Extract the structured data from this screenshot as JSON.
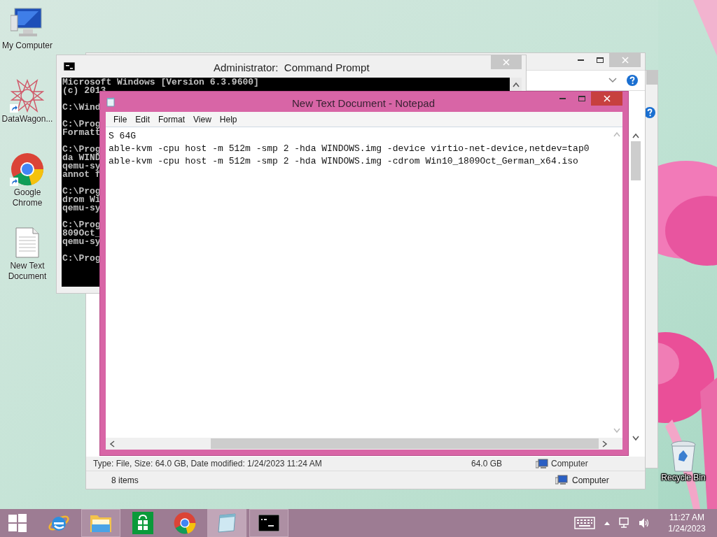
{
  "desktop_icons": [
    {
      "kind": "computer",
      "label": "My Computer",
      "shortcut": false
    },
    {
      "kind": "star",
      "label": "DataWagon...",
      "shortcut": true
    },
    {
      "kind": "chrome",
      "label": "Google Chrome",
      "shortcut": true
    },
    {
      "kind": "document",
      "label": "New Text Document",
      "shortcut": false
    }
  ],
  "recycle_bin": {
    "label": "Recycle Bin"
  },
  "explorer": {
    "details": {
      "summary": "Type: File, Size: 64.0 GB, Date modified: 1/24/2023 11:24 AM",
      "size": "64.0 GB",
      "location": "Computer"
    },
    "status": {
      "items": "8 items",
      "location": "Computer"
    }
  },
  "command_prompt": {
    "title": "Administrator:  Command Prompt",
    "blocks": [
      [
        "Microsoft Windows [Version 6.3.9600]",
        "(c) 2013"
      ],
      [
        "C:\\Wind"
      ],
      [
        "C:\\Prog",
        "Formatt"
      ],
      [
        "C:\\Prog",
        "da WIND",
        "qemu-sy",
        "annot f"
      ],
      [
        "C:\\Prog",
        "drom Wi",
        "qemu-sy"
      ],
      [
        "C:\\Prog",
        "809Oct_",
        "qemu-sy"
      ],
      [
        "C:\\Prog"
      ]
    ]
  },
  "notepad": {
    "title": "New Text Document - Notepad",
    "menu": [
      "File",
      "Edit",
      "Format",
      "View",
      "Help"
    ],
    "lines": [
      "S 64G",
      "able-kvm -cpu host -m 512m -smp 2 -hda WINDOWS.img -device virtio-net-device,netdev=tap0",
      "able-kvm -cpu host -m 512m -smp 2 -hda WINDOWS.img -cdrom Win10_1809Oct_German_x64.iso"
    ]
  },
  "taskbar": {
    "apps": [
      {
        "kind": "ie",
        "running": false,
        "active": false
      },
      {
        "kind": "explorer",
        "running": true,
        "active": false
      },
      {
        "kind": "store",
        "running": false,
        "active": false
      },
      {
        "kind": "chrome",
        "running": false,
        "active": false
      },
      {
        "kind": "notepad",
        "running": true,
        "active": true
      },
      {
        "kind": "cmd",
        "running": true,
        "active": false
      }
    ],
    "clock": {
      "time": "11:27 AM",
      "date": "1/24/2023"
    }
  }
}
